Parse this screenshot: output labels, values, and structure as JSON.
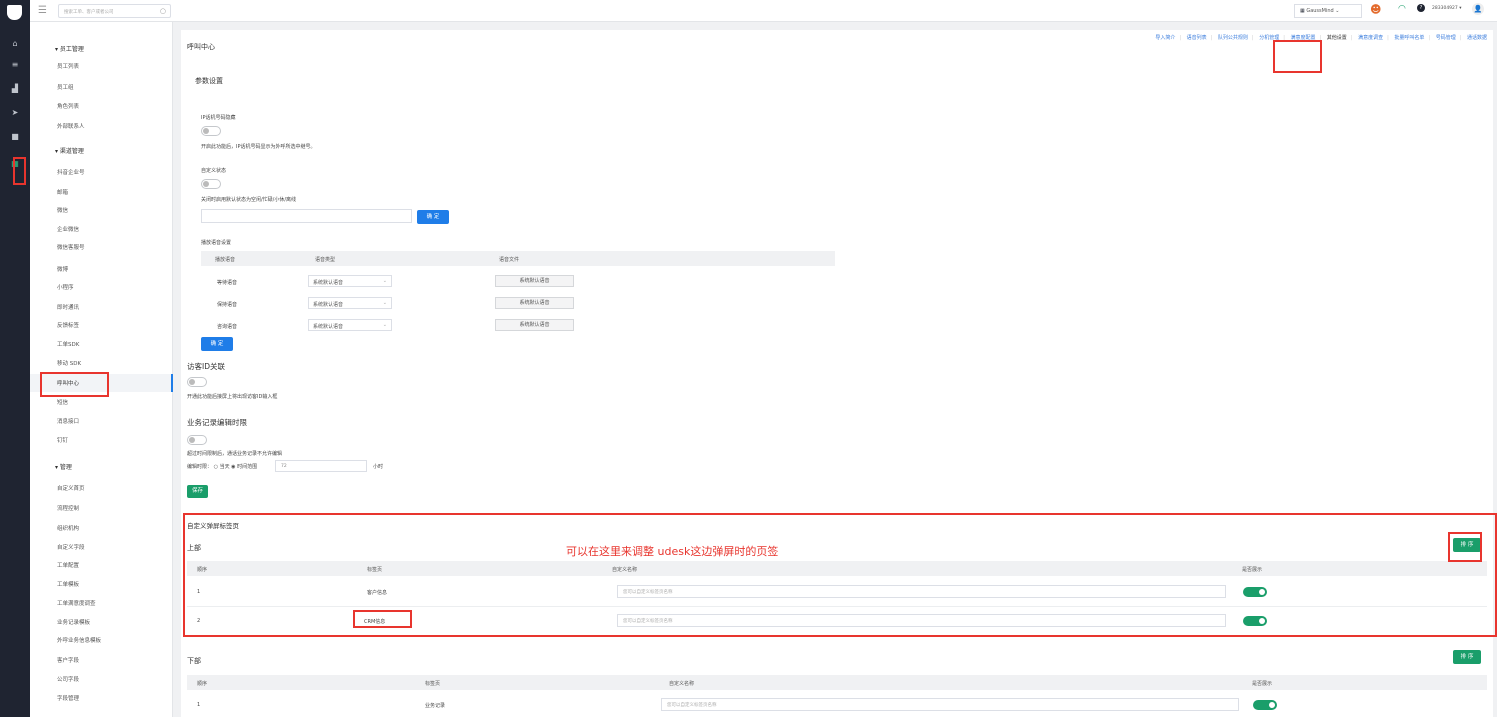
{
  "topbar": {
    "search_placeholder": "搜索工单、客户或者公司",
    "workspace": "GaussMind",
    "account": "283304927",
    "help": "?"
  },
  "sidebar": {
    "groups": [
      {
        "label": "员工管理",
        "items": [
          "员工列表",
          "员工组",
          "角色列表",
          "外部联系人"
        ]
      },
      {
        "label": "渠道管理",
        "items": [
          "抖音企业号",
          "邮箱",
          "微信",
          "企业微信",
          "微信客服号",
          "微博",
          "小程序",
          "即时通讯",
          "反馈标签",
          "工单SDK",
          "移动 SDK",
          "呼叫中心",
          "短信",
          "消息接口",
          "钉钉"
        ]
      },
      {
        "label": "管理",
        "items": [
          "自定义首页",
          "流程控制",
          "组织机构",
          "自定义字段",
          "工单配置",
          "工单模板",
          "工单满意度调查",
          "业务记录模板",
          "外呼业务信息模板",
          "客户字段",
          "公司字段",
          "字段管理"
        ]
      }
    ]
  },
  "page": {
    "title": "呼叫中心",
    "tabs": [
      "导入简介",
      "语音列表",
      "队列公共规则",
      "分机管理",
      "满意度配置",
      "其他设置",
      "满意度调查",
      "批量呼叫名单",
      "号码管理",
      "通话数据"
    ]
  },
  "params": {
    "title": "参数设置",
    "ip_label": "IP话机号码隐藏",
    "ip_desc": "开启此功能后，IP话机号码显示为外呼所选中继号。",
    "status_label": "自定义状态",
    "status_desc": "关闭时启用默认状态为空闲/忙碌/小休/离线",
    "confirm": "确 定",
    "voice_title": "播放语音设置",
    "voice_cols": [
      "播放语音",
      "语音类型",
      "语音文件"
    ],
    "voice_rows": [
      {
        "name": "等待语音",
        "type": "系统默认语音",
        "file": "系统默认语音"
      },
      {
        "name": "保持语音",
        "type": "系统默认语音",
        "file": "系统默认语音"
      },
      {
        "name": "咨询语音",
        "type": "系统默认语音",
        "file": "系统默认语音"
      }
    ]
  },
  "visitor": {
    "title": "访客ID关联",
    "desc": "开通此功能后接屏上将出现访客ID输入框"
  },
  "bizrec": {
    "title": "业务记录编辑时限",
    "desc": "超过时间限制后，通话业务记录不允许编辑",
    "limit_label": "编辑时限：",
    "opt1": "当天",
    "opt2": "时间范围",
    "value": "72",
    "unit": "小时",
    "save": "保存"
  },
  "popup": {
    "title": "自定义弹屏标签页",
    "annotation": "可以在这里来调整  udesk这边弹屏时的页签",
    "upper": {
      "label": "上部",
      "sort": "排 序",
      "cols": [
        "顺序",
        "标签页",
        "自定义名称",
        "是否展示"
      ],
      "rows": [
        {
          "no": "1",
          "tab": "客户信息",
          "placeholder": "您可以自定义标签页名称"
        },
        {
          "no": "2",
          "tab": "CRM信息",
          "placeholder": "您可以自定义标签页名称"
        }
      ]
    },
    "lower": {
      "label": "下部",
      "sort": "排 序",
      "cols": [
        "顺序",
        "标签页",
        "自定义名称",
        "是否展示"
      ],
      "rows": [
        {
          "no": "1",
          "tab": "业务记录",
          "placeholder": "您可以自定义标签页名称"
        }
      ]
    }
  },
  "colors": {
    "accent": "#1f7de8",
    "green": "#1a9e6a",
    "highlight": "#e8352e",
    "rail": "#1f2431"
  }
}
